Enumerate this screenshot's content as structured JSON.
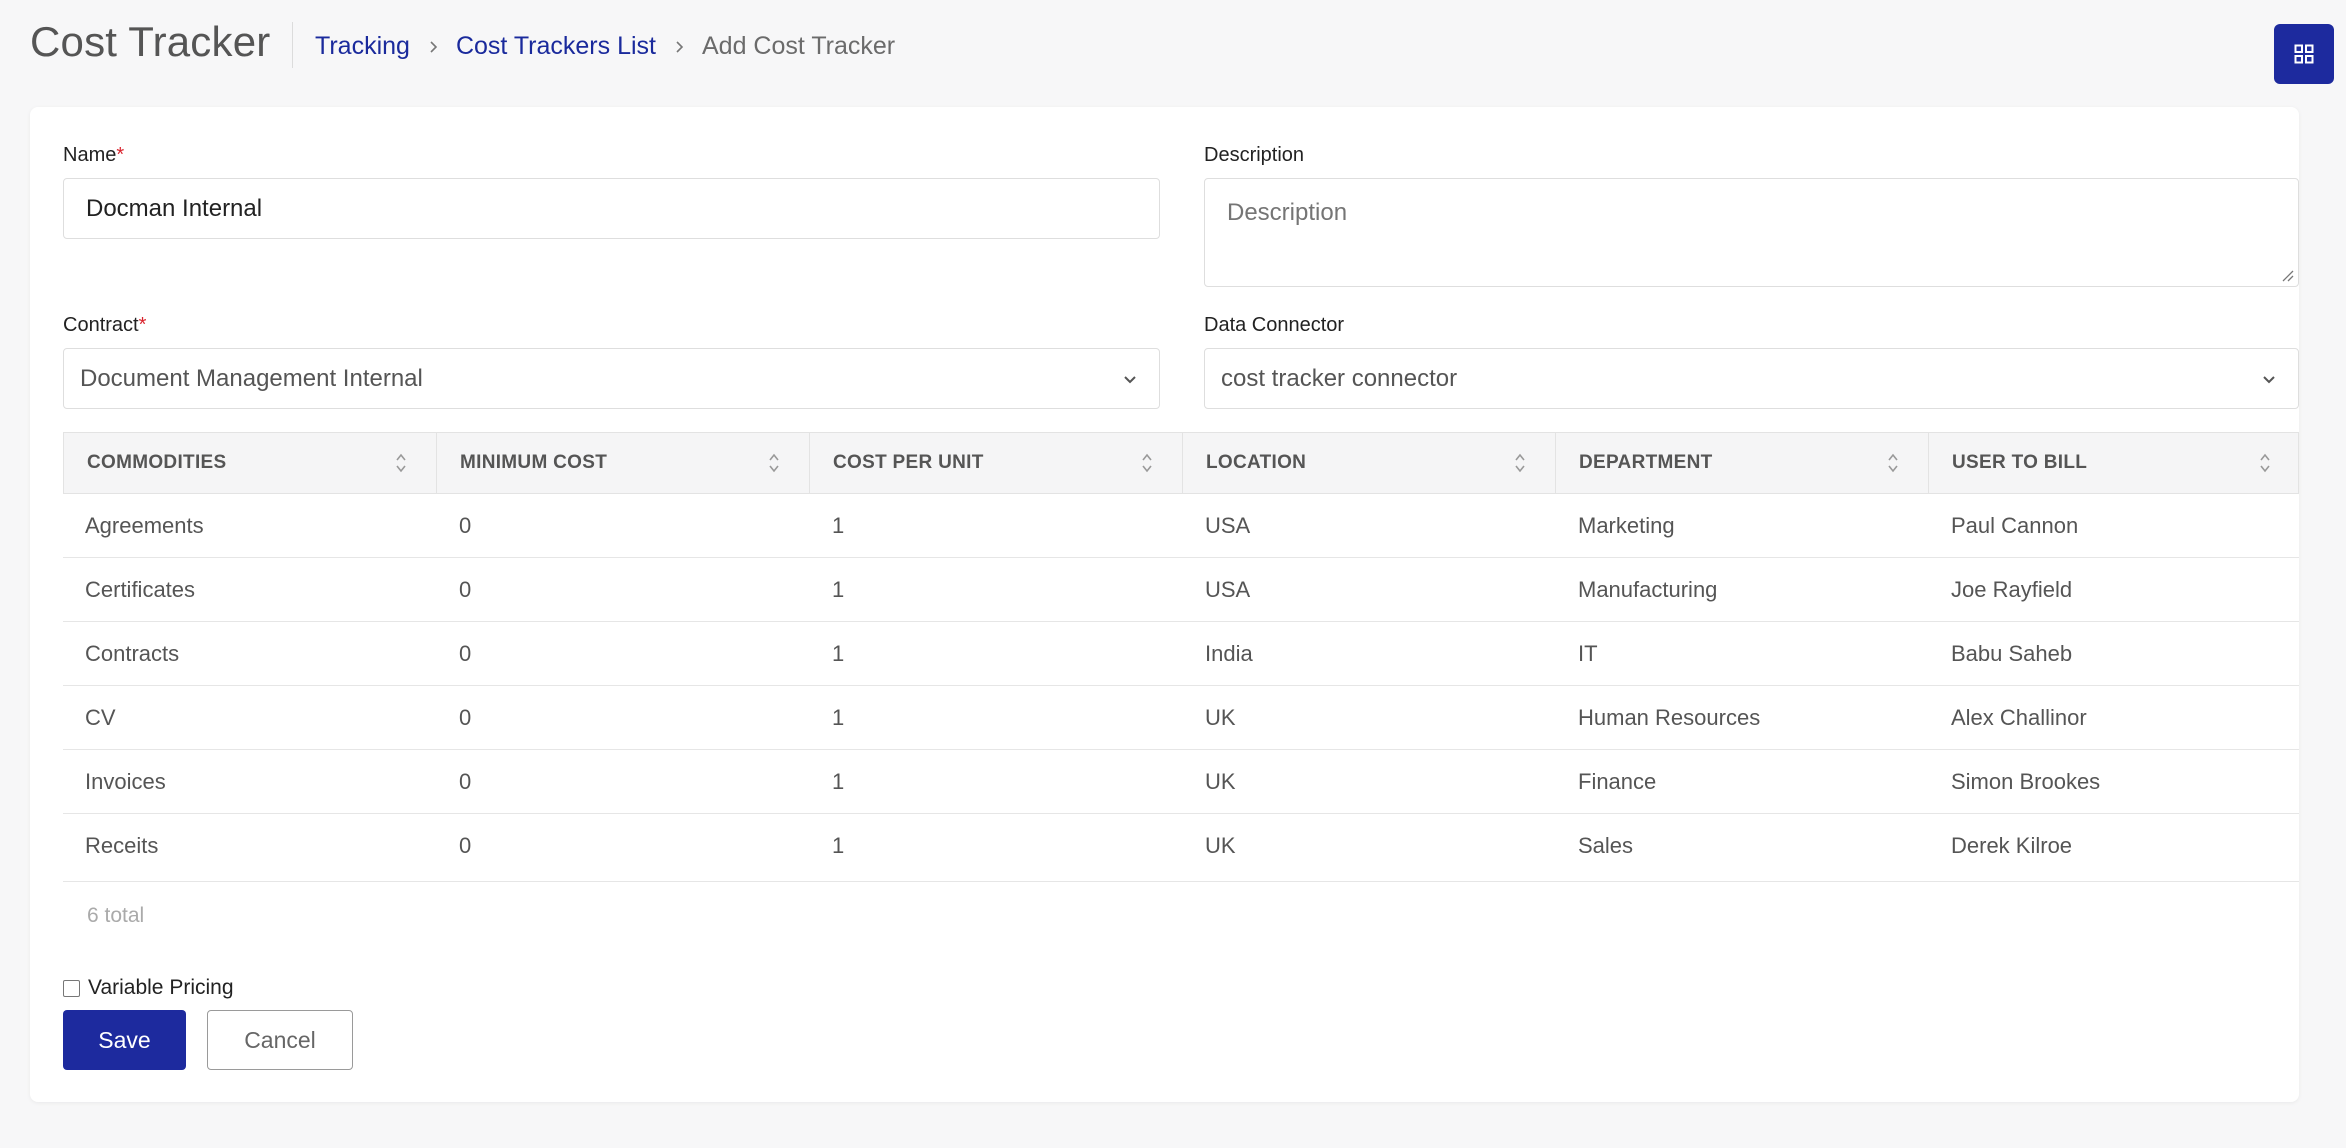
{
  "header": {
    "title": "Cost Tracker",
    "breadcrumb": {
      "tracking": "Tracking",
      "list": "Cost Trackers List",
      "current": "Add Cost Tracker"
    },
    "apps_icon": "grid-icon"
  },
  "form": {
    "name": {
      "label": "Name",
      "required_mark": "*",
      "value": "Docman Internal"
    },
    "description": {
      "label": "Description",
      "placeholder": "Description",
      "value": ""
    },
    "contract": {
      "label": "Contract",
      "required_mark": "*",
      "value": "Document Management Internal"
    },
    "data_connector": {
      "label": "Data Connector",
      "value": "cost tracker connector"
    }
  },
  "table": {
    "columns": [
      "COMMODITIES",
      "MINIMUM COST",
      "COST PER UNIT",
      "LOCATION",
      "DEPARTMENT",
      "USER TO BILL"
    ],
    "rows": [
      [
        "Agreements",
        "0",
        "1",
        "USA",
        "Marketing",
        "Paul Cannon"
      ],
      [
        "Certificates",
        "0",
        "1",
        "USA",
        "Manufacturing",
        "Joe Rayfield"
      ],
      [
        "Contracts",
        "0",
        "1",
        "India",
        "IT",
        "Babu Saheb"
      ],
      [
        "CV",
        "0",
        "1",
        "UK",
        "Human Resources",
        "Alex Challinor"
      ],
      [
        "Invoices",
        "0",
        "1",
        "UK",
        "Finance",
        "Simon Brookes"
      ],
      [
        "Receits",
        "0",
        "1",
        "UK",
        "Sales",
        "Derek Kilroe"
      ]
    ],
    "total": "6 total"
  },
  "variable_pricing": {
    "label": "Variable Pricing",
    "checked": false
  },
  "buttons": {
    "save": "Save",
    "cancel": "Cancel"
  },
  "colors": {
    "primary": "#1d2a9e",
    "link": "#1a2a9c",
    "required": "#d9232d"
  }
}
